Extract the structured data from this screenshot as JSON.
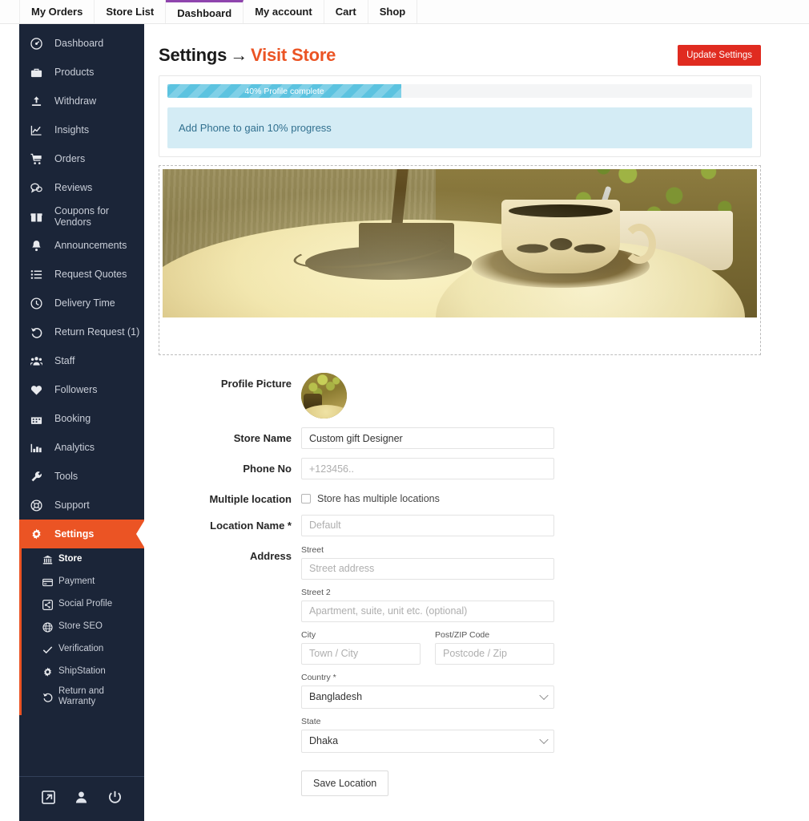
{
  "topnav": {
    "items": [
      {
        "label": "My Orders",
        "active": false
      },
      {
        "label": "Store List",
        "active": false
      },
      {
        "label": "Dashboard",
        "active": true
      },
      {
        "label": "My account",
        "active": false
      },
      {
        "label": "Cart",
        "active": false
      },
      {
        "label": "Shop",
        "active": false
      }
    ],
    "active_underline_color": "#8e44ad"
  },
  "sidebar": {
    "background": "#1b2538",
    "active_color": "#eb5424",
    "items": [
      {
        "label": "Dashboard",
        "icon": "speedometer-icon"
      },
      {
        "label": "Products",
        "icon": "briefcase-icon"
      },
      {
        "label": "Withdraw",
        "icon": "upload-icon"
      },
      {
        "label": "Insights",
        "icon": "line-chart-icon"
      },
      {
        "label": "Orders",
        "icon": "shopping-cart-icon"
      },
      {
        "label": "Reviews",
        "icon": "chat-bubbles-icon"
      },
      {
        "label": "Coupons for Vendors",
        "icon": "gift-icon"
      },
      {
        "label": "Announcements",
        "icon": "bell-icon"
      },
      {
        "label": "Request Quotes",
        "icon": "list-icon"
      },
      {
        "label": "Delivery Time",
        "icon": "clock-icon"
      },
      {
        "label": "Return Request (1)",
        "icon": "undo-icon"
      },
      {
        "label": "Staff",
        "icon": "users-icon"
      },
      {
        "label": "Followers",
        "icon": "heart-icon"
      },
      {
        "label": "Booking",
        "icon": "calendar-icon"
      },
      {
        "label": "Analytics",
        "icon": "bar-chart-icon"
      },
      {
        "label": "Tools",
        "icon": "wrench-icon"
      },
      {
        "label": "Support",
        "icon": "lifebuoy-icon"
      },
      {
        "label": "Settings",
        "icon": "gear-icon",
        "active": true
      }
    ],
    "submenu": [
      {
        "label": "Store",
        "icon": "bank-icon",
        "active": true
      },
      {
        "label": "Payment",
        "icon": "credit-card-icon"
      },
      {
        "label": "Social Profile",
        "icon": "share-icon"
      },
      {
        "label": "Store SEO",
        "icon": "globe-icon"
      },
      {
        "label": "Verification",
        "icon": "check-icon"
      },
      {
        "label": "ShipStation",
        "icon": "gear-icon"
      },
      {
        "label": "Return and Warranty",
        "icon": "undo-icon"
      }
    ],
    "footer_icons": [
      {
        "name": "external-link-icon"
      },
      {
        "name": "user-icon"
      },
      {
        "name": "power-icon"
      }
    ]
  },
  "header": {
    "title": "Settings",
    "arrow": "→",
    "accent_title": "Visit Store",
    "update_button": "Update Settings",
    "update_button_color": "#e02b20"
  },
  "progress": {
    "percent": 40,
    "percent_width": "40%",
    "label": "40% Profile complete",
    "fill_color": "#5cc3e0"
  },
  "notice": {
    "text": "Add Phone to gain 10% progress",
    "background": "#d4ecf5",
    "text_color": "#31708f"
  },
  "banner": {
    "alt": "store banner photo of a decorated teacup on a lamp-lit table with a plant"
  },
  "form": {
    "profile_picture_label": "Profile Picture",
    "store_name_label": "Store Name",
    "store_name_value": "Custom gift Designer",
    "phone_label": "Phone No",
    "phone_placeholder": "+123456..",
    "multiple_location_label": "Multiple location",
    "multiple_location_checkbox_label": "Store has multiple locations",
    "multiple_location_checked": false,
    "location_name_label": "Location Name *",
    "location_name_placeholder": "Default",
    "address_label": "Address",
    "street_label": "Street",
    "street_placeholder": "Street address",
    "street2_label": "Street 2",
    "street2_placeholder": "Apartment, suite, unit etc. (optional)",
    "city_label": "City",
    "city_placeholder": "Town / City",
    "zip_label": "Post/ZIP Code",
    "zip_placeholder": "Postcode / Zip",
    "country_label": "Country *",
    "country_value": "Bangladesh",
    "state_label": "State",
    "state_value": "Dhaka",
    "save_location_button": "Save Location"
  }
}
